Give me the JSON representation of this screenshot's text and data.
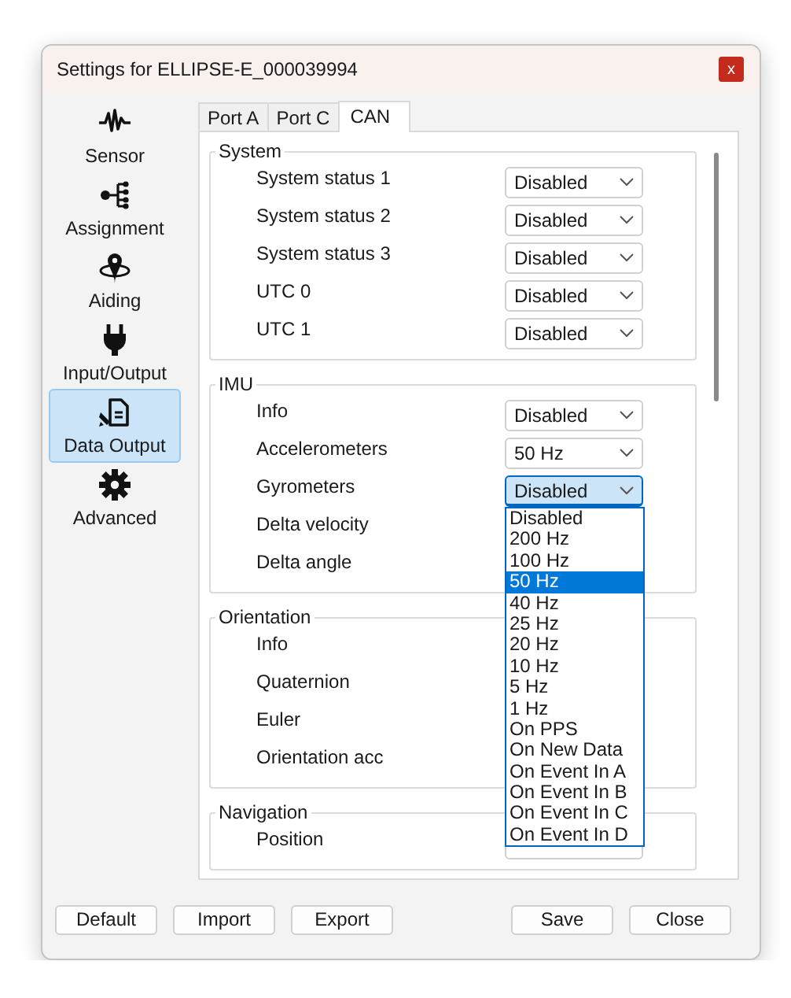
{
  "window": {
    "title": "Settings for ELLIPSE-E_000039994",
    "close_glyph": "x"
  },
  "sidebar": {
    "items": [
      {
        "label": "Sensor",
        "kind": "waveform",
        "selected": false
      },
      {
        "label": "Assignment",
        "kind": "tree",
        "selected": false
      },
      {
        "label": "Aiding",
        "kind": "pin",
        "selected": false
      },
      {
        "label": "Input/Output",
        "kind": "plug",
        "selected": false
      },
      {
        "label": "Data Output",
        "kind": "document",
        "selected": true
      },
      {
        "label": "Advanced",
        "kind": "gear",
        "selected": false
      }
    ]
  },
  "tabs": [
    {
      "label": "Port A",
      "selected": false
    },
    {
      "label": "Port C",
      "selected": false
    },
    {
      "label": "CAN",
      "selected": true
    }
  ],
  "groups": [
    {
      "title": "System",
      "rows": [
        {
          "label": "System status 1",
          "value": "Disabled"
        },
        {
          "label": "System status 2",
          "value": "Disabled"
        },
        {
          "label": "System status 3",
          "value": "Disabled"
        },
        {
          "label": "UTC 0",
          "value": "Disabled"
        },
        {
          "label": "UTC 1",
          "value": "Disabled"
        }
      ]
    },
    {
      "title": "IMU",
      "rows": [
        {
          "label": "Info",
          "value": "Disabled"
        },
        {
          "label": "Accelerometers",
          "value": "50 Hz"
        },
        {
          "label": "Gyrometers",
          "value": "Disabled",
          "expanded": true,
          "options": [
            {
              "label": "Disabled",
              "highlighted": false
            },
            {
              "label": "200 Hz",
              "highlighted": false
            },
            {
              "label": "100 Hz",
              "highlighted": false
            },
            {
              "label": "50 Hz",
              "highlighted": true
            },
            {
              "label": "40 Hz",
              "highlighted": false
            },
            {
              "label": "25 Hz",
              "highlighted": false
            },
            {
              "label": "20 Hz",
              "highlighted": false
            },
            {
              "label": "10 Hz",
              "highlighted": false
            },
            {
              "label": "5 Hz",
              "highlighted": false
            },
            {
              "label": "1 Hz",
              "highlighted": false
            },
            {
              "label": "On PPS",
              "highlighted": false
            },
            {
              "label": "On New Data",
              "highlighted": false
            },
            {
              "label": "On Event In A",
              "highlighted": false
            },
            {
              "label": "On Event In B",
              "highlighted": false
            },
            {
              "label": "On Event In C",
              "highlighted": false
            },
            {
              "label": "On Event In D",
              "highlighted": false
            }
          ]
        },
        {
          "label": "Delta velocity"
        },
        {
          "label": "Delta angle"
        }
      ]
    },
    {
      "title": "Orientation",
      "rows": [
        {
          "label": "Info"
        },
        {
          "label": "Quaternion"
        },
        {
          "label": "Euler"
        },
        {
          "label": "Orientation acc"
        }
      ]
    },
    {
      "title": "Navigation",
      "rows": [
        {
          "label": "Position",
          "has_dropdown": true
        }
      ]
    }
  ],
  "buttons": {
    "left": [
      "Default",
      "Import",
      "Export"
    ],
    "right": [
      "Save",
      "Close"
    ]
  }
}
